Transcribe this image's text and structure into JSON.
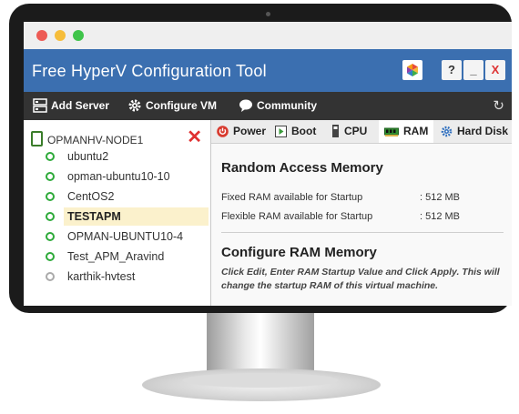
{
  "window": {
    "title": "Free HyperV Configuration Tool",
    "buttons": {
      "help": "?",
      "minimize": "_",
      "close": "X"
    },
    "traffic_lights": [
      "#ed5b55",
      "#f6bd3a",
      "#3fc44a"
    ]
  },
  "toolbar": {
    "add_server": "Add Server",
    "configure_vm": "Configure VM",
    "community": "Community"
  },
  "tree": {
    "host": "OPMANHV-NODE1",
    "vms": [
      {
        "name": "ubuntu2",
        "state": "running"
      },
      {
        "name": "opman-ubuntu10-10",
        "state": "running"
      },
      {
        "name": "CentOS2",
        "state": "running"
      },
      {
        "name": "TESTAPM",
        "state": "running",
        "selected": true
      },
      {
        "name": "OPMAN-UBUNTU10-4",
        "state": "running"
      },
      {
        "name": "Test_APM_Aravind",
        "state": "running"
      },
      {
        "name": "karthik-hvtest",
        "state": "off"
      }
    ]
  },
  "tabs": [
    {
      "label": "Power",
      "icon": "power-icon"
    },
    {
      "label": "Boot",
      "icon": "boot-icon"
    },
    {
      "label": "CPU",
      "icon": "cpu-icon"
    },
    {
      "label": "RAM",
      "icon": "ram-icon",
      "active": true
    },
    {
      "label": "Hard Disk",
      "icon": "gear-icon"
    }
  ],
  "ram": {
    "heading": "Random Access Memory",
    "fixed_label": "Fixed RAM available for Startup",
    "fixed_value": ": 512  MB",
    "flex_label": "Flexible RAM available for Startup",
    "flex_value": ": 512   MB",
    "config_heading": "Configure RAM Memory",
    "note": "Click Edit, Enter RAM Startup Value and Click Apply. This will change the startup RAM of this virtual machine."
  },
  "colors": {
    "title_bar": "#3b6fb0",
    "toolbar": "#333333",
    "selected_row": "#fbf1cc",
    "running": "#2eaa3a",
    "close_red": "#e03030"
  }
}
